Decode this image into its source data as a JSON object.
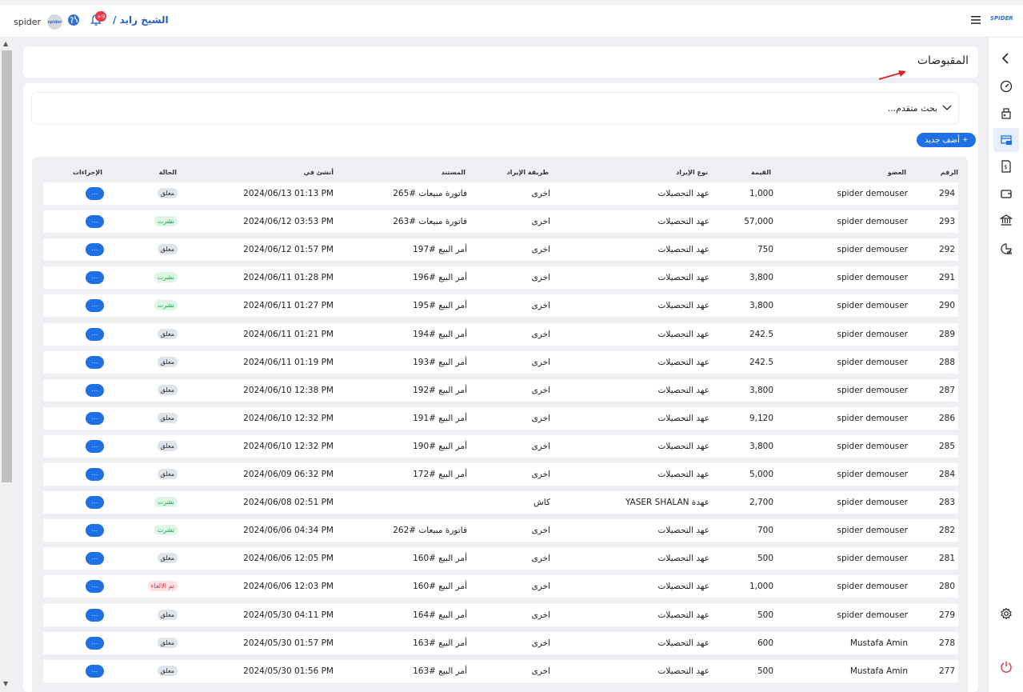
{
  "header": {
    "user_name": "spider",
    "avatar_text": "spider",
    "notifications_count": "+9",
    "branch": "الشيخ زايد /",
    "logo_text": "SPIDER"
  },
  "page": {
    "title": "المقبوضات"
  },
  "search": {
    "label": "بحث متقدم..."
  },
  "add_button": {
    "label": "أضف جديد",
    "icon": "+"
  },
  "table": {
    "headers": {
      "num": "الرقم",
      "member": "العضو",
      "value": "القيمة",
      "revenue_type": "نوع الإيراد",
      "revenue_method": "طريقة الإيراد",
      "document": "المستند",
      "created_at": "أنشئ في",
      "status": "الحالة",
      "actions": "الإجراءات"
    },
    "action_label": "···",
    "rows": [
      {
        "num": "294",
        "member": "spider demouser",
        "value": "1,000",
        "type": "عهد التحصيلات",
        "method": "اخرى",
        "doc": "فاتورة مبيعات #265",
        "date": "2024/06/13 01:13 PM",
        "status": "معلق",
        "status_kind": "pending"
      },
      {
        "num": "293",
        "member": "spider demouser",
        "value": "57,000",
        "type": "عهد التحصيلات",
        "method": "اخرى",
        "doc": "فاتورة مبيعات #263",
        "date": "2024/06/12 03:53 PM",
        "status": "نشرت",
        "status_kind": "posted"
      },
      {
        "num": "292",
        "member": "spider demouser",
        "value": "750",
        "type": "عهد التحصيلات",
        "method": "اخرى",
        "doc": "أمر البيع #197",
        "date": "2024/06/12 01:57 PM",
        "status": "معلق",
        "status_kind": "pending"
      },
      {
        "num": "291",
        "member": "spider demouser",
        "value": "3,800",
        "type": "عهد التحصيلات",
        "method": "اخرى",
        "doc": "أمر البيع #196",
        "date": "2024/06/11 01:28 PM",
        "status": "نشرت",
        "status_kind": "posted"
      },
      {
        "num": "290",
        "member": "spider demouser",
        "value": "3,800",
        "type": "عهد التحصيلات",
        "method": "اخرى",
        "doc": "أمر البيع #195",
        "date": "2024/06/11 01:27 PM",
        "status": "نشرت",
        "status_kind": "posted"
      },
      {
        "num": "289",
        "member": "spider demouser",
        "value": "242.5",
        "type": "عهد التحصيلات",
        "method": "اخرى",
        "doc": "أمر البيع #194",
        "date": "2024/06/11 01:21 PM",
        "status": "معلق",
        "status_kind": "pending"
      },
      {
        "num": "288",
        "member": "spider demouser",
        "value": "242.5",
        "type": "عهد التحصيلات",
        "method": "اخرى",
        "doc": "أمر البيع #193",
        "date": "2024/06/11 01:19 PM",
        "status": "معلق",
        "status_kind": "pending"
      },
      {
        "num": "287",
        "member": "spider demouser",
        "value": "3,800",
        "type": "عهد التحصيلات",
        "method": "اخرى",
        "doc": "أمر البيع #192",
        "date": "2024/06/10 12:38 PM",
        "status": "معلق",
        "status_kind": "pending"
      },
      {
        "num": "286",
        "member": "spider demouser",
        "value": "9,120",
        "type": "عهد التحصيلات",
        "method": "اخرى",
        "doc": "أمر البيع #191",
        "date": "2024/06/10 12:32 PM",
        "status": "معلق",
        "status_kind": "pending"
      },
      {
        "num": "285",
        "member": "spider demouser",
        "value": "3,800",
        "type": "عهد التحصيلات",
        "method": "اخرى",
        "doc": "أمر البيع #190",
        "date": "2024/06/10 12:32 PM",
        "status": "معلق",
        "status_kind": "pending"
      },
      {
        "num": "284",
        "member": "spider demouser",
        "value": "5,000",
        "type": "عهد التحصيلات",
        "method": "اخرى",
        "doc": "أمر البيع #172",
        "date": "2024/06/09 06:32 PM",
        "status": "معلق",
        "status_kind": "pending"
      },
      {
        "num": "283",
        "member": "spider demouser",
        "value": "2,700",
        "type": "عهدة YASER SHALAN",
        "method": "كاش",
        "doc": "",
        "date": "2024/06/08 02:51 PM",
        "status": "نشرت",
        "status_kind": "posted"
      },
      {
        "num": "282",
        "member": "spider demouser",
        "value": "700",
        "type": "عهد التحصيلات",
        "method": "اخرى",
        "doc": "فاتورة مبيعات #262",
        "date": "2024/06/06 04:34 PM",
        "status": "نشرت",
        "status_kind": "posted"
      },
      {
        "num": "281",
        "member": "spider demouser",
        "value": "500",
        "type": "عهد التحصيلات",
        "method": "اخرى",
        "doc": "أمر البيع #160",
        "date": "2024/06/06 12:05 PM",
        "status": "معلق",
        "status_kind": "pending"
      },
      {
        "num": "280",
        "member": "spider demouser",
        "value": "1,000",
        "type": "عهد التحصيلات",
        "method": "اخرى",
        "doc": "أمر البيع #160",
        "date": "2024/06/06 12:03 PM",
        "status": "تم الالغاء",
        "status_kind": "cancel"
      },
      {
        "num": "279",
        "member": "spider demouser",
        "value": "500",
        "type": "عهد التحصيلات",
        "method": "اخرى",
        "doc": "أمر البيع #164",
        "date": "2024/05/30 04:11 PM",
        "status": "معلق",
        "status_kind": "pending"
      },
      {
        "num": "278",
        "member": "Mustafa Amin",
        "value": "600",
        "type": "عهد التحصيلات",
        "method": "اخرى",
        "doc": "أمر البيع #163",
        "date": "2024/05/30 01:57 PM",
        "status": "معلق",
        "status_kind": "pending"
      },
      {
        "num": "277",
        "member": "Mustafa Amin",
        "value": "500",
        "type": "عهد التحصيلات",
        "method": "اخرى",
        "doc": "أمر البيع #163",
        "date": "2024/05/30 01:56 PM",
        "status": "معلق",
        "status_kind": "pending"
      }
    ]
  },
  "rail_icons": [
    "chevron-left-icon",
    "dashboard-icon",
    "cash-register-icon",
    "receipts-icon",
    "invoice-icon",
    "wallet-icon",
    "bank-icon",
    "reports-icon",
    "settings-icon",
    "power-icon"
  ],
  "colors": {
    "accent": "#1f6fe5",
    "pending_bg": "#dfe3ea",
    "posted_text": "#21a657",
    "cancel_text": "#e0303f",
    "notification_badge": "#e5364a"
  }
}
